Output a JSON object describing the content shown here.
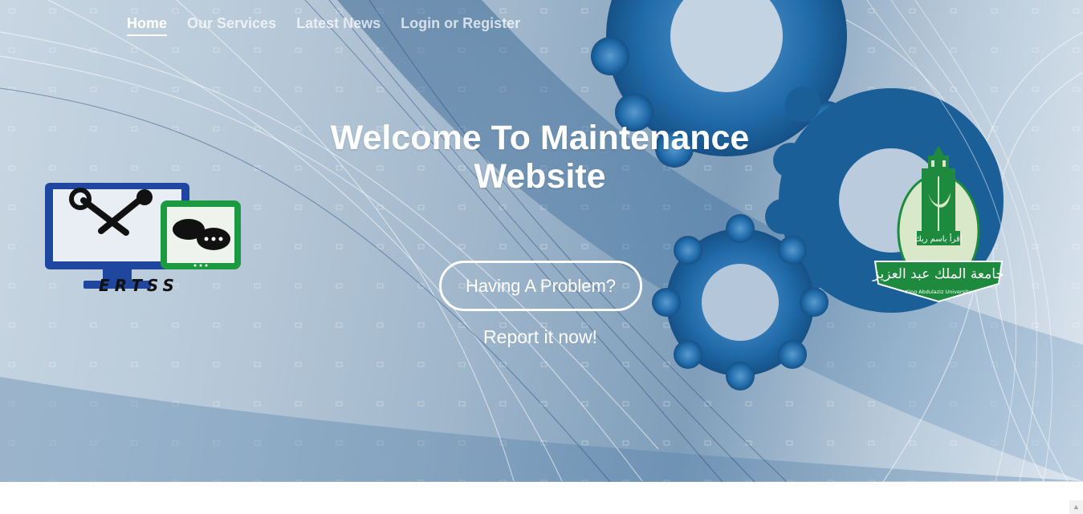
{
  "nav": {
    "items": [
      {
        "label": "Home",
        "active": true
      },
      {
        "label": "Our Services",
        "active": false
      },
      {
        "label": "Latest News",
        "active": false
      },
      {
        "label": "Login or Register",
        "active": false
      }
    ]
  },
  "hero": {
    "title": "Welcome To Maintenance Website",
    "cta_button": "Having A Problem?",
    "cta_subtext": "Report it now!"
  },
  "logos": {
    "left_text": "ERTSS",
    "right_arabic": "جامعة الملك عبد العزيز",
    "right_motto": "اقرأ باسم ربك",
    "right_english": "King Abdulaziz University"
  },
  "icons": {
    "left_logo": "tools-monitor-chat-icon",
    "right_logo": "university-emblem-icon",
    "scroll": "scroll-up-arrow-icon"
  },
  "colors": {
    "hero_gradient_dark": "#1a5a8a",
    "text": "#ffffff",
    "kau_green": "#1e8a3e",
    "ertss_blue": "#1f47a0",
    "ertss_green": "#1c9a3f"
  }
}
